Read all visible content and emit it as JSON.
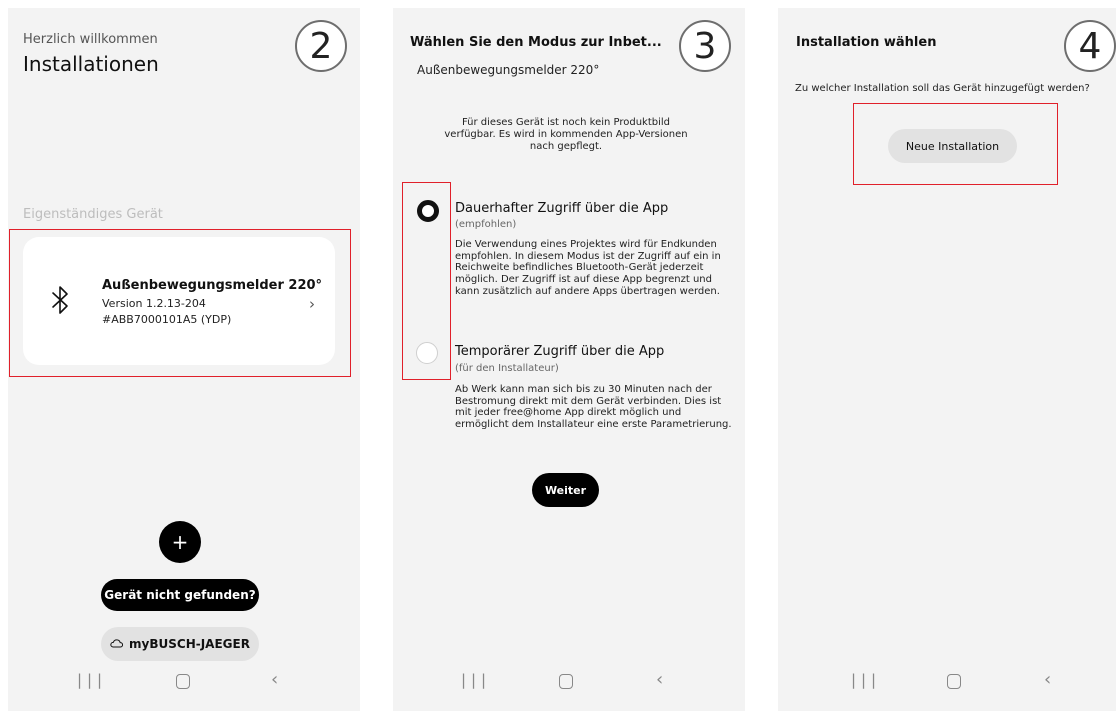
{
  "screen1": {
    "step": "2",
    "greeting": "Herzlich willkommen",
    "title": "Installationen",
    "section_label": "Eigenständiges Gerät",
    "device": {
      "name": "Außenbewegungsmelder 220°",
      "version": "Version 1.2.13-204",
      "id": "#ABB7000101A5 (YDP)",
      "icon": "bluetooth-icon"
    },
    "add_symbol": "+",
    "not_found_label": "Gerät nicht gefunden?",
    "cloud_label": "myBUSCH-JAEGER"
  },
  "screen2": {
    "step": "3",
    "title": "Wählen Sie den Modus zur Inbet...",
    "subtitle": "Außenbewegungsmelder 220°",
    "no_image_text": "Für dieses Gerät ist noch kein Produktbild verfügbar. Es wird in kommenden App-Versionen nach gepflegt.",
    "options": [
      {
        "title": "Dauerhafter Zugriff über die App",
        "hint": "(empfohlen)",
        "description": "Die Verwendung eines Projektes wird für Endkunden empfohlen. In diesem Modus ist der Zugriff auf ein in Reichweite befindliches Bluetooth-Gerät jederzeit möglich. Der Zugriff ist auf diese App begrenzt und kann zusätzlich auf andere Apps übertragen werden.",
        "selected": true
      },
      {
        "title": "Temporärer Zugriff über die App",
        "hint": "(für den Installateur)",
        "description": "Ab Werk kann man sich bis zu 30 Minuten nach der Bestromung direkt mit dem Gerät verbinden. Dies ist mit jeder free@home App direkt möglich und ermöglicht dem Installateur eine erste Parametrierung.",
        "selected": false
      }
    ],
    "next_label": "Weiter"
  },
  "screen3": {
    "step": "4",
    "title": "Installation wählen",
    "question": "Zu welcher Installation soll das Gerät hinzugefügt werden?",
    "new_installation_label": "Neue Installation"
  },
  "colors": {
    "highlight": "#e0202a",
    "screen_bg": "#f3f3f3",
    "primary_button": "#000000",
    "secondary_button": "#e2e2e2"
  },
  "nav_icons": [
    "recents-icon",
    "home-icon",
    "back-icon"
  ]
}
